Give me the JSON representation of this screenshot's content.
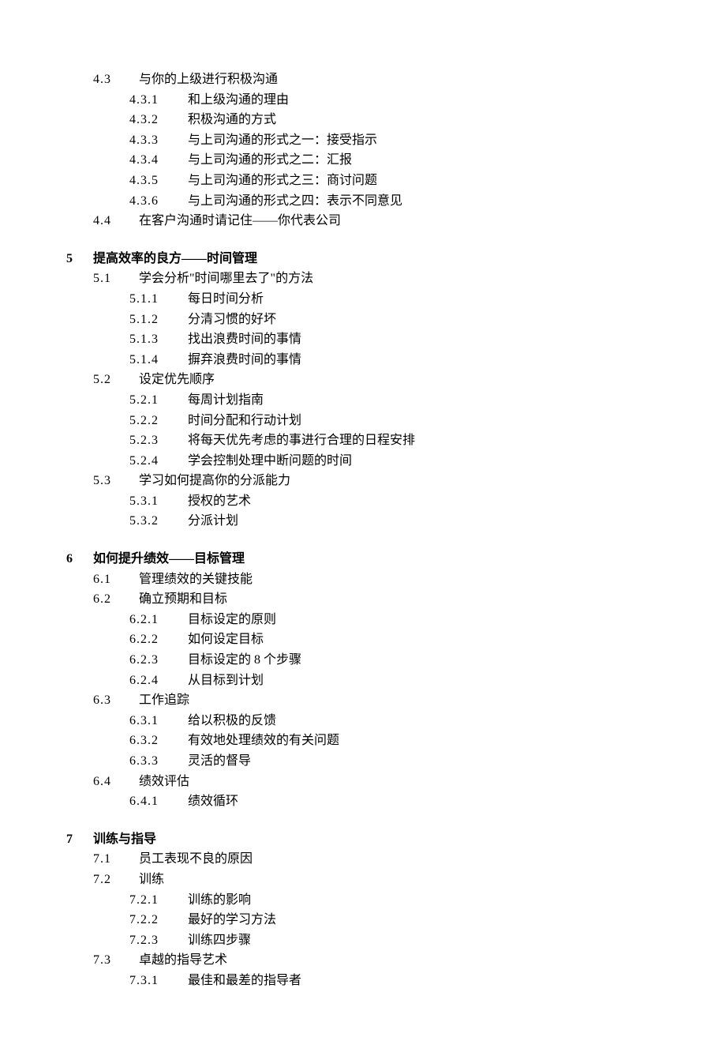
{
  "outline": [
    {
      "type": "section",
      "num": "4.3",
      "title": "与你的上级进行积极沟通",
      "items": [
        {
          "num": "4.3.1",
          "title": "和上级沟通的理由"
        },
        {
          "num": "4.3.2",
          "title": "积极沟通的方式"
        },
        {
          "num": "4.3.3",
          "title": "与上司沟通的形式之一：接受指示"
        },
        {
          "num": "4.3.4",
          "title": "与上司沟通的形式之二：汇报"
        },
        {
          "num": "4.3.5",
          "title": "与上司沟通的形式之三：商讨问题"
        },
        {
          "num": "4.3.6",
          "title": "与上司沟通的形式之四：表示不同意见"
        }
      ]
    },
    {
      "type": "section",
      "num": "4.4",
      "title": "在客户沟通时请记住——你代表公司",
      "items": []
    },
    {
      "type": "chapter",
      "num": "5",
      "title": "提高效率的良方——时间管理"
    },
    {
      "type": "section",
      "num": "5.1",
      "title": "学会分析\"时间哪里去了\"的方法",
      "items": [
        {
          "num": "5.1.1",
          "title": "每日时间分析"
        },
        {
          "num": "5.1.2",
          "title": "分清习惯的好坏"
        },
        {
          "num": "5.1.3",
          "title": "找出浪费时间的事情"
        },
        {
          "num": "5.1.4",
          "title": "摒弃浪费时间的事情"
        }
      ]
    },
    {
      "type": "section",
      "num": "5.2",
      "title": "设定优先顺序",
      "items": [
        {
          "num": "5.2.1",
          "title": "每周计划指南"
        },
        {
          "num": "5.2.2",
          "title": "时间分配和行动计划"
        },
        {
          "num": "5.2.3",
          "title": "将每天优先考虑的事进行合理的日程安排"
        },
        {
          "num": "5.2.4",
          "title": "学会控制处理中断问题的时间"
        }
      ]
    },
    {
      "type": "section",
      "num": "5.3",
      "title": "学习如何提高你的分派能力",
      "items": [
        {
          "num": "5.3.1",
          "title": "授权的艺术"
        },
        {
          "num": "5.3.2",
          "title": "分派计划"
        }
      ]
    },
    {
      "type": "chapter",
      "num": "6",
      "title": "如何提升绩效——目标管理"
    },
    {
      "type": "section",
      "num": "6.1",
      "title": "管理绩效的关键技能",
      "items": []
    },
    {
      "type": "section",
      "num": "6.2",
      "title": "确立预期和目标",
      "items": [
        {
          "num": "6.2.1",
          "title": "目标设定的原则"
        },
        {
          "num": "6.2.2",
          "title": "如何设定目标"
        },
        {
          "num": "6.2.3",
          "title": "目标设定的 8 个步骤"
        },
        {
          "num": "6.2.4",
          "title": "从目标到计划"
        }
      ]
    },
    {
      "type": "section",
      "num": "6.3",
      "title": "工作追踪",
      "items": [
        {
          "num": "6.3.1",
          "title": "给以积极的反馈"
        },
        {
          "num": "6.3.2",
          "title": "有效地处理绩效的有关问题"
        },
        {
          "num": "6.3.3",
          "title": "灵活的督导"
        }
      ]
    },
    {
      "type": "section",
      "num": "6.4",
      "title": "绩效评估",
      "items": [
        {
          "num": "6.4.1",
          "title": "绩效循环"
        }
      ]
    },
    {
      "type": "chapter",
      "num": "7",
      "title": "训练与指导"
    },
    {
      "type": "section",
      "num": "7.1",
      "title": "员工表现不良的原因",
      "items": []
    },
    {
      "type": "section",
      "num": "7.2",
      "title": "训练",
      "items": [
        {
          "num": "7.2.1",
          "title": "训练的影响"
        },
        {
          "num": "7.2.2",
          "title": "最好的学习方法"
        },
        {
          "num": "7.2.3",
          "title": "训练四步骤"
        }
      ]
    },
    {
      "type": "section",
      "num": "7.3",
      "title": "卓越的指导艺术",
      "items": [
        {
          "num": "7.3.1",
          "title": "最佳和最差的指导者"
        }
      ]
    }
  ]
}
